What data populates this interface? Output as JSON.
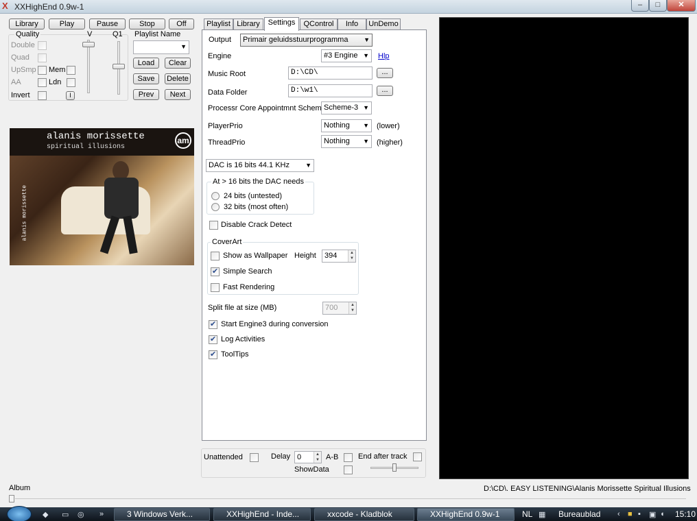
{
  "window": {
    "title": "XXHighEnd 0.9w-1",
    "minimize": "–",
    "maximize": "□",
    "close": "✕"
  },
  "transport": {
    "library": "Library",
    "play": "Play",
    "pause": "Pause",
    "stop": "Stop",
    "off": "Off"
  },
  "quality": {
    "title": "Quality",
    "v_label": "V",
    "q1_label": "Q1",
    "double": "Double",
    "quad": "Quad",
    "upsmp": "UpSmp",
    "mem": "Mem",
    "aa": "AA",
    "ldn": "Ldn",
    "invert": "Invert",
    "i_button": "I"
  },
  "playlist": {
    "title": "Playlist Name",
    "name_value": "",
    "load": "Load",
    "clear": "Clear",
    "save": "Save",
    "delete": "Delete",
    "prev": "Prev",
    "next": "Next"
  },
  "cover": {
    "artist": "alanis morissette",
    "album": "spiritual illusions",
    "logo": "am",
    "side_text": "alanis morissette"
  },
  "tabs": [
    "Playlist",
    "Library",
    "Settings",
    "QControl",
    "Info",
    "UnDemo"
  ],
  "active_tab": "Settings",
  "settings": {
    "output_label": "Output",
    "output_value": "Primair geluidsstuurprogramma",
    "engine_label": "Engine",
    "engine_value": "#3 Engine",
    "engine_help": "Hlp",
    "music_root_label": "Music Root",
    "music_root_value": "D:\\CD\\",
    "data_folder_label": "Data Folder",
    "data_folder_value": "D:\\w1\\",
    "browse": "...",
    "core_label": "Processr Core Appointmnt Scheme",
    "core_value": "Scheme-3",
    "player_prio_label": "PlayerPrio",
    "player_prio_value": "Nothing",
    "player_prio_note": "(lower)",
    "thread_prio_label": "ThreadPrio",
    "thread_prio_value": "Nothing",
    "thread_prio_note": "(higher)",
    "dac_value": "DAC is 16 bits  44.1 KHz",
    "dac_group_title": "At > 16 bits the DAC needs",
    "bits24": "24 bits (untested)",
    "bits32": "32 bits (most often)",
    "disable_crack": "Disable Crack Detect",
    "coverart_title": "CoverArt",
    "wallpaper": "Show as Wallpaper",
    "height_label": "Height",
    "height_value": "394",
    "simple_search": "Simple Search",
    "fast_render": "Fast Rendering",
    "split_label": "Split file at size (MB)",
    "split_value": "700",
    "start_engine": "Start Engine3 during conversion",
    "log": "Log Activities",
    "tooltips": "ToolTips"
  },
  "bottom": {
    "unattended": "Unattended",
    "delay": "Delay",
    "delay_value": "0",
    "ab": "A-B",
    "end_after": "End after track",
    "show_data": "ShowData"
  },
  "status": {
    "album_label": "Album",
    "path": "D:\\CD\\. EASY LISTENING\\Alanis Morissette  Spiritual Illusions"
  },
  "taskbar": {
    "tasks": [
      "3 Windows Verk...",
      "XXHighEnd - Inde...",
      "xxcode - Kladblok",
      "XXHighEnd 0.9w-1"
    ],
    "lang": "NL",
    "desktop": "Bureaublad",
    "clock": "15:10"
  }
}
